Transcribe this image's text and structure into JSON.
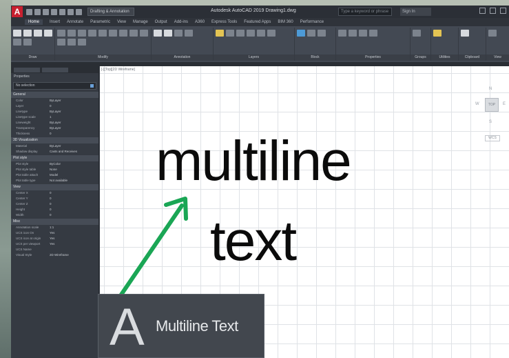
{
  "app": {
    "logo": "A",
    "title": "Autodesk AutoCAD 2019   Drawing1.dwg",
    "workspace": "Drafting & Annotation",
    "search_placeholder": "Type a keyword or phrase",
    "signin": "Sign In"
  },
  "ribbon": {
    "tabs": [
      "Home",
      "Insert",
      "Annotate",
      "Parametric",
      "View",
      "Manage",
      "Output",
      "Add-ins",
      "A360",
      "Express Tools",
      "Featured Apps",
      "BIM 360",
      "Performance"
    ],
    "groups": [
      "Draw",
      "Modify",
      "Annotation",
      "Layers",
      "Block",
      "Properties",
      "Groups",
      "Utilities",
      "Clipboard",
      "View"
    ]
  },
  "palette": {
    "tabs": [
      "Model",
      "Layout1"
    ],
    "title": "Properties",
    "selection": "No selection",
    "sections": [
      {
        "name": "General",
        "props": [
          [
            "Color",
            "ByLayer"
          ],
          [
            "Layer",
            "0"
          ],
          [
            "Linetype",
            "ByLayer"
          ],
          [
            "Linetype scale",
            "1"
          ],
          [
            "Lineweight",
            "ByLayer"
          ],
          [
            "Transparency",
            "ByLayer"
          ],
          [
            "Thickness",
            "0"
          ]
        ]
      },
      {
        "name": "3D Visualization",
        "props": [
          [
            "Material",
            "ByLayer"
          ],
          [
            "Shadow display",
            "Casts and Receives"
          ]
        ]
      },
      {
        "name": "Plot style",
        "props": [
          [
            "Plot style",
            "ByColor"
          ],
          [
            "Plot style table",
            "None"
          ],
          [
            "Plot table attach",
            "Model"
          ],
          [
            "Plot table type",
            "Not available"
          ]
        ]
      },
      {
        "name": "View",
        "props": [
          [
            "Center X",
            "0"
          ],
          [
            "Center Y",
            "0"
          ],
          [
            "Center Z",
            "0"
          ],
          [
            "Height",
            "0"
          ],
          [
            "Width",
            "0"
          ]
        ]
      },
      {
        "name": "Misc",
        "props": [
          [
            "Annotation scale",
            "1:1"
          ],
          [
            "UCS icon On",
            "Yes"
          ],
          [
            "UCS icon at origin",
            "Yes"
          ],
          [
            "UCS per viewport",
            "Yes"
          ],
          [
            "UCS Name",
            ""
          ],
          [
            "Visual Style",
            "2D Wireframe"
          ]
        ]
      }
    ]
  },
  "canvas": {
    "viewport_label": "[-][Top][2D Wireframe]",
    "viewcube": {
      "top": "N",
      "face": "TOP",
      "west": "W",
      "east": "E",
      "south": "S",
      "wcs": "WCS"
    },
    "text_line1": "multiline",
    "text_line2": "text"
  },
  "tooltip": {
    "icon_letter": "A",
    "label": "Multiline Text"
  },
  "colors": {
    "arrow": "#1aa655",
    "ribbon": "#434953",
    "canvas": "#ffffff"
  }
}
